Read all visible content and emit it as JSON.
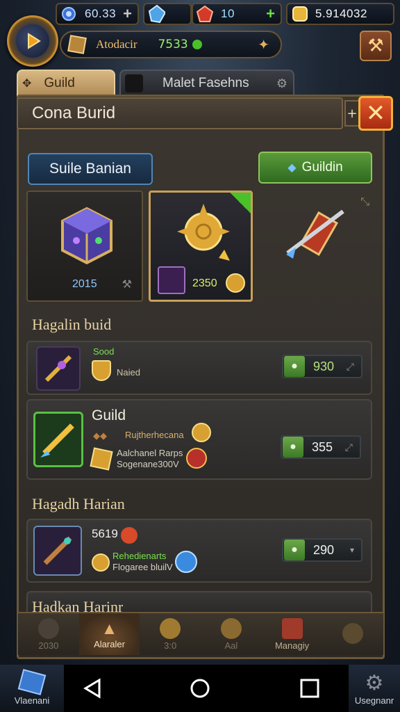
{
  "currency": {
    "gems": "60.33",
    "energy": "10",
    "gold": "5.914032"
  },
  "player": {
    "name": "Atodacir",
    "power": "7533"
  },
  "tabs": [
    {
      "label": "Guild",
      "active": true
    },
    {
      "label": "Malet Fasehns",
      "active": false
    }
  ],
  "panel": {
    "title": "Cona Burid",
    "plus_label": "+",
    "blue_button": "Suile Banian",
    "green_button": "Guildin"
  },
  "featured": [
    {
      "name": "cube",
      "value": "2015"
    },
    {
      "name": "golden-shield",
      "value": "2350",
      "selected": true
    },
    {
      "name": "crossbow",
      "value": ""
    }
  ],
  "sections": [
    {
      "title": "Hagalin buid",
      "items": [
        {
          "line1": "Sood",
          "line2": "Naied",
          "price": "930"
        }
      ]
    },
    {
      "title": "",
      "items": [
        {
          "name": "Guild",
          "line1": "Rujtherhecana",
          "line2": "Aalchanel Rarps",
          "line3": "Sogenane300V",
          "price": "355"
        }
      ]
    },
    {
      "title": "Hagadh Harian",
      "items": [
        {
          "count": "5619",
          "line1": "Rehedienarts",
          "line2": "Flogaree bluilV",
          "price": "290"
        }
      ]
    },
    {
      "title": "Hadkan Harinr",
      "items": []
    }
  ],
  "bottom_nav": [
    {
      "label": "2030",
      "active": false
    },
    {
      "label": "Alaraler",
      "active": true
    },
    {
      "label": "3:0",
      "active": false
    },
    {
      "label": "Aal",
      "active": false
    },
    {
      "label": "Managiy",
      "active": false
    },
    {
      "label": "",
      "active": false
    }
  ],
  "system_bar": {
    "left_label": "Vlaenani",
    "right_label": "Usegnanr"
  },
  "colors": {
    "accent_gold": "#c9a15a",
    "green": "#5a9a3a",
    "blue": "#4f86b6",
    "close_red": "#e25a2a"
  }
}
